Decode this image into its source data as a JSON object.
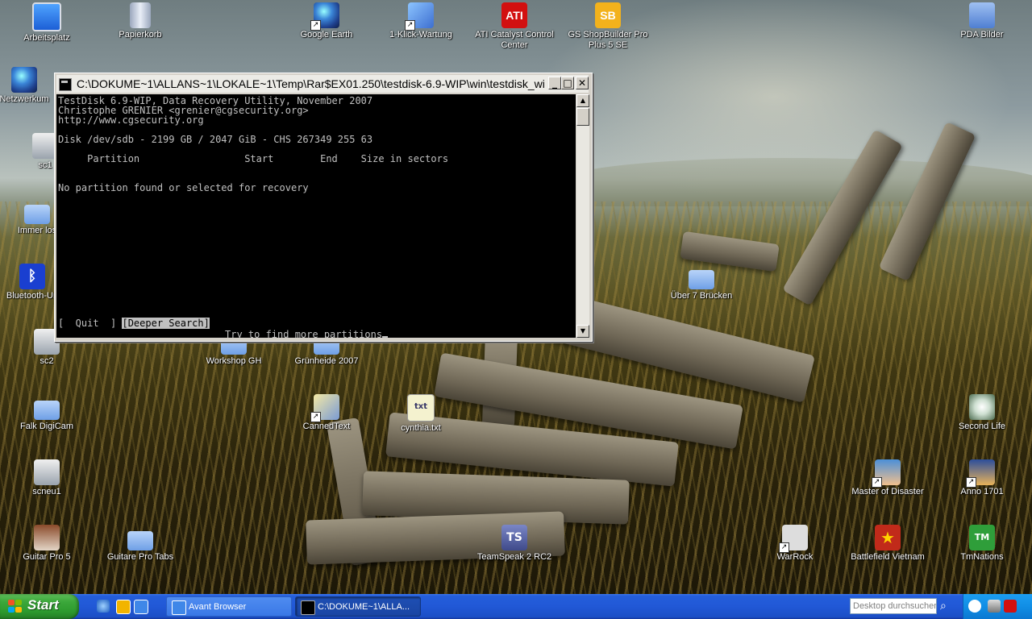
{
  "desktop": {
    "icons": [
      {
        "label": "Arbeitsplatz",
        "icon": "computer-icon"
      },
      {
        "label": "Papierkorb",
        "icon": "recycle-bin-icon"
      },
      {
        "label": "Google Earth",
        "icon": "google-earth-icon"
      },
      {
        "label": "1-Klick-Wartung",
        "icon": "maintenance-icon"
      },
      {
        "label": "ATI Catalyst Control Center",
        "icon": "ati-icon",
        "glyph": "ATI"
      },
      {
        "label": "GS ShopBuilder Pro Plus 5 SE",
        "icon": "shopbuilder-icon",
        "glyph": "SB"
      },
      {
        "label": "PDA Bilder",
        "icon": "folder-icon"
      },
      {
        "label": "Netzwerkum",
        "icon": "network-icon"
      },
      {
        "label": "sc1",
        "icon": "camera-icon"
      },
      {
        "label": "Immer los",
        "icon": "folder-icon"
      },
      {
        "label": "Bluetooth-Un",
        "icon": "bluetooth-icon",
        "glyph": "ᛒ"
      },
      {
        "label": "sc2",
        "icon": "camera-icon"
      },
      {
        "label": "Falk DigiCam",
        "icon": "folder-icon"
      },
      {
        "label": "scneu1",
        "icon": "camera-icon"
      },
      {
        "label": "Guitar Pro 5",
        "icon": "guitar-pro-icon"
      },
      {
        "label": "Guitare Pro Tabs",
        "icon": "folder-icon"
      },
      {
        "label": "Workshop GH",
        "icon": "folder-icon"
      },
      {
        "label": "Grünheide 2007",
        "icon": "folder-icon"
      },
      {
        "label": "CannedText",
        "icon": "canned-text-icon"
      },
      {
        "label": "cynthia.txt",
        "icon": "text-file-icon",
        "glyph": "txt"
      },
      {
        "label": "TeamSpeak 2 RC2",
        "icon": "teamspeak-icon",
        "glyph": "TS"
      },
      {
        "label": "Über 7 Brücken",
        "icon": "folder-icon"
      },
      {
        "label": "Second Life",
        "icon": "second-life-icon"
      },
      {
        "label": "Master of Disaster",
        "icon": "game-icon"
      },
      {
        "label": "Anno 1701",
        "icon": "game-icon"
      },
      {
        "label": "WarRock",
        "icon": "warrock-icon"
      },
      {
        "label": "Battlefield Vietnam",
        "icon": "battlefield-icon",
        "glyph": "★"
      },
      {
        "label": "TmNations",
        "icon": "tmnations-icon",
        "glyph": "TM"
      }
    ]
  },
  "console": {
    "title": "C:\\DOKUME~1\\ALLANS~1\\LOKALE~1\\Temp\\Rar$EX01.250\\testdisk-6.9-WIP\\win\\testdisk_wi...",
    "lines": [
      "TestDisk 6.9-WIP, Data Recovery Utility, November 2007",
      "Christophe GRENIER <grenier@cgsecurity.org>",
      "http://www.cgsecurity.org",
      "Disk /dev/sdb - 2199 GB / 2047 GiB - CHS 267349 255 63",
      "     Partition                  Start        End    Size in sectors",
      "No partition found or selected for recovery"
    ],
    "menu": {
      "quit": "[  Quit  ]",
      "deeper": "[Deeper Search]",
      "hint": "Try to find more partitions"
    },
    "buttons": {
      "minimize": "_",
      "maximize": "□",
      "close": "✕"
    }
  },
  "taskbar": {
    "start_label": "Start",
    "quicklaunch": [
      "ie-icon",
      "outlook-icon",
      "avant-icon"
    ],
    "tasks": [
      {
        "label": "Avant Browser",
        "icon": "avant-browser-icon",
        "active": false
      },
      {
        "label": "C:\\DOKUME~1\\ALLA...",
        "icon": "console-icon",
        "active": true
      }
    ],
    "search_placeholder": "Desktop durchsuchen",
    "tray_icons": [
      "back-icon",
      "network-tray-icon",
      "security-tray-icon"
    ]
  }
}
